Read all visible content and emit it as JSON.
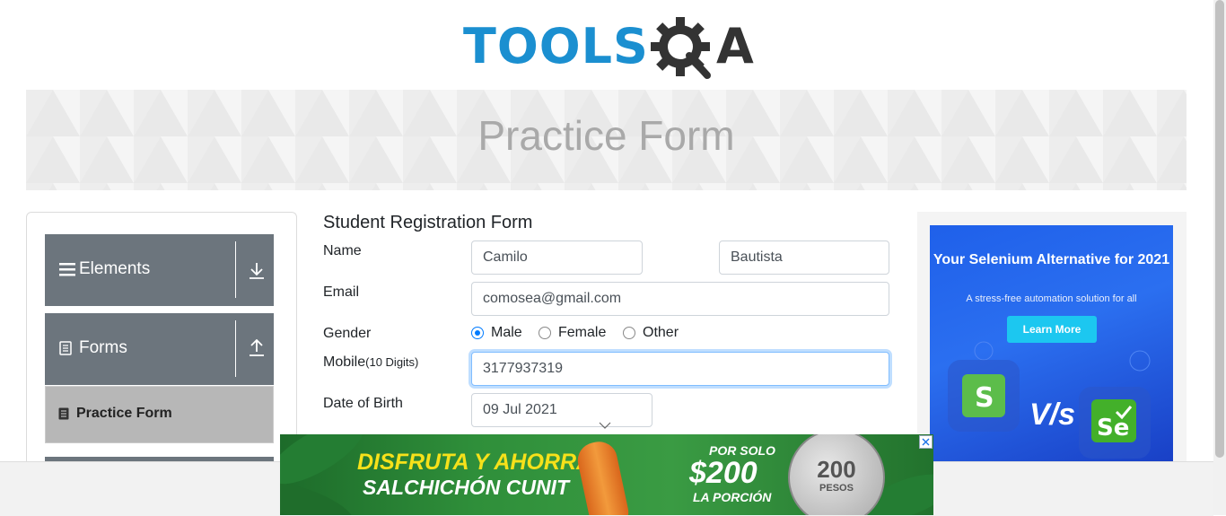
{
  "header": {
    "logo_text": "TOOLS",
    "logo_suffix": "A"
  },
  "banner": {
    "title": "Practice Form"
  },
  "sidebar": {
    "groups": [
      {
        "label": "Elements"
      },
      {
        "label": "Forms"
      }
    ],
    "active_item": {
      "label": "Practice Form"
    }
  },
  "form": {
    "title": "Student Registration Form",
    "name_label": "Name",
    "first_name": "Camilo",
    "last_name": "Bautista",
    "email_label": "Email",
    "email": "comosea@gmail.com",
    "gender_label": "Gender",
    "gender_options": [
      "Male",
      "Female",
      "Other"
    ],
    "gender_selected": "Male",
    "mobile_label": "Mobile",
    "mobile_hint": "(10 Digits)",
    "mobile": "3177937319",
    "dob_label": "Date of Birth",
    "dob": "09 Jul 2021"
  },
  "ad_right": {
    "headline": "Your Selenium Alternative for 2021",
    "sub": "A stress-free automation solution for all",
    "button": "Learn More",
    "vs": "V/s",
    "left_logo": "S",
    "right_logo": "Se"
  },
  "ad_bottom": {
    "line1": "DISFRUTA Y AHORRA",
    "line2": "SALCHICHÓN CUNIT",
    "price_top": "POR SOLO",
    "price": "$200",
    "price_bottom": "LA PORCIÓN",
    "coin_value": "200",
    "coin_text": "PESOS"
  },
  "colors": {
    "brand_blue": "#1b8fd0",
    "sidebar_gray": "#6c757d",
    "focus_blue": "#80bdff"
  }
}
